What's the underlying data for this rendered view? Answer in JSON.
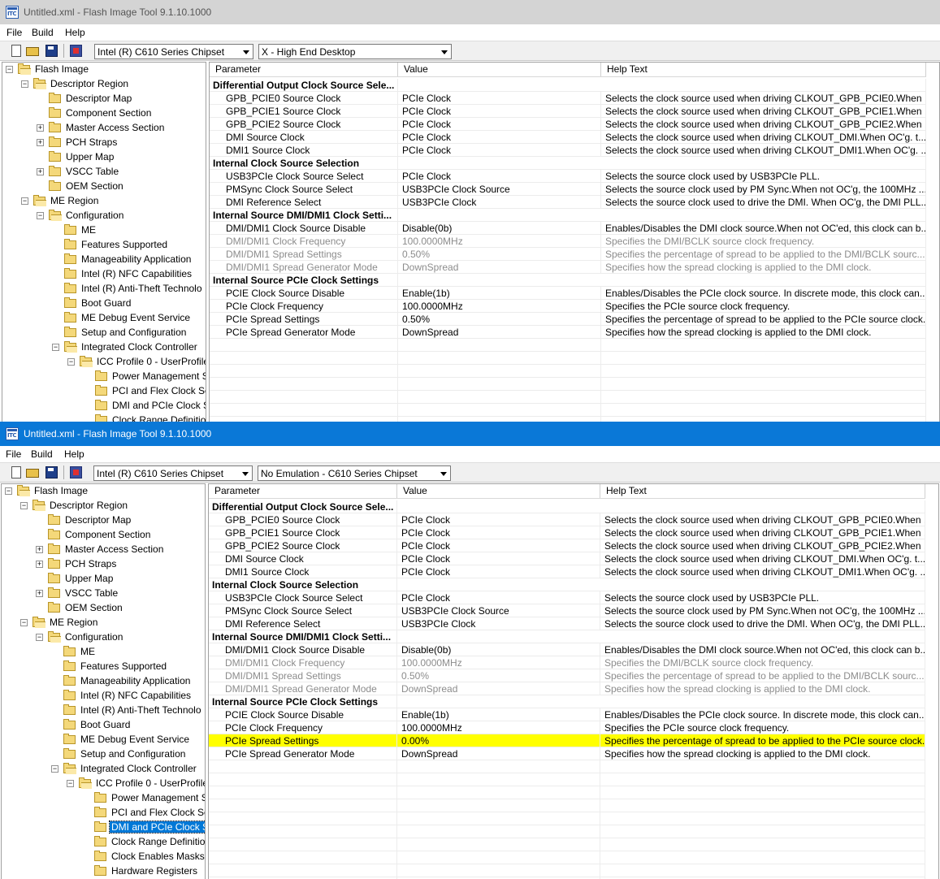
{
  "windows": [
    {
      "title": "Untitled.xml - Flash Image Tool 9.1.10.1000",
      "menu": [
        "File",
        "Build",
        "Help"
      ],
      "chipset": "Intel (R) C610 Series Chipset",
      "emulation": "X - High End Desktop",
      "tree": [
        {
          "label": "Flash Image",
          "level": 0,
          "twisty": "-",
          "open": true
        },
        {
          "label": "Descriptor Region",
          "level": 1,
          "twisty": "-",
          "open": true
        },
        {
          "label": "Descriptor Map",
          "level": 2
        },
        {
          "label": "Component Section",
          "level": 2
        },
        {
          "label": "Master Access Section",
          "level": 2,
          "twisty": "+"
        },
        {
          "label": "PCH Straps",
          "level": 2,
          "twisty": "+"
        },
        {
          "label": "Upper Map",
          "level": 2
        },
        {
          "label": "VSCC Table",
          "level": 2,
          "twisty": "+"
        },
        {
          "label": "OEM Section",
          "level": 2
        },
        {
          "label": "ME Region",
          "level": 1,
          "twisty": "-",
          "open": true
        },
        {
          "label": "Configuration",
          "level": 2,
          "twisty": "-",
          "open": true
        },
        {
          "label": "ME",
          "level": 3
        },
        {
          "label": "Features Supported",
          "level": 3
        },
        {
          "label": "Manageability Application",
          "level": 3
        },
        {
          "label": "Intel (R) NFC Capabilities",
          "level": 3
        },
        {
          "label": "Intel (R) Anti-Theft Technolo",
          "level": 3
        },
        {
          "label": "Boot Guard",
          "level": 3
        },
        {
          "label": "ME Debug Event Service",
          "level": 3
        },
        {
          "label": "Setup and Configuration",
          "level": 3
        },
        {
          "label": "Integrated Clock Controller",
          "level": 3,
          "twisty": "-",
          "open": true
        },
        {
          "label": "ICC Profile 0 - UserProfile",
          "level": 4,
          "twisty": "-",
          "open": true
        },
        {
          "label": "Power Management S",
          "level": 5
        },
        {
          "label": "PCI and Flex Clock Set",
          "level": 5
        },
        {
          "label": "DMI and PCIe Clock S",
          "level": 5
        },
        {
          "label": "Clock Range Definitio",
          "level": 5
        }
      ],
      "columns": [
        "Parameter",
        "Value",
        "Help Text"
      ],
      "rows": [
        {
          "type": "section",
          "param": "Differential Output Clock Source Sele..."
        },
        {
          "param": "GPB_PCIE0 Source Clock",
          "value": "PCIe Clock",
          "help": "Selects the clock source used when driving CLKOUT_GPB_PCIE0.When ..."
        },
        {
          "param": "GPB_PCIE1 Source Clock",
          "value": "PCIe Clock",
          "help": "Selects the clock source used when driving CLKOUT_GPB_PCIE1.When ..."
        },
        {
          "param": "GPB_PCIE2 Source Clock",
          "value": "PCIe Clock",
          "help": "Selects the clock source used when driving CLKOUT_GPB_PCIE2.When ..."
        },
        {
          "param": "DMI Source Clock",
          "value": "PCIe Clock",
          "help": "Selects the clock source used when driving CLKOUT_DMI.When OC'g. t..."
        },
        {
          "param": "DMI1 Source Clock",
          "value": "PCIe Clock",
          "help": "Selects the clock source used when driving CLKOUT_DMI1.When OC'g. ..."
        },
        {
          "type": "section",
          "param": "Internal Clock Source Selection"
        },
        {
          "param": "USB3PCIe Clock Source Select",
          "value": "PCIe Clock",
          "help": "Selects the source clock used by USB3PCIe PLL."
        },
        {
          "param": "PMSync Clock Source Select",
          "value": "USB3PCIe Clock Source",
          "help": "Selects the source clock used by PM Sync.When not OC'g, the 100MHz ..."
        },
        {
          "param": "DMI Reference Select",
          "value": "USB3PCIe Clock",
          "help": "Selects the source clock used to drive the DMI. When OC'g, the DMI PLL..."
        },
        {
          "type": "section",
          "param": "Internal Source DMI/DMI1 Clock Setti..."
        },
        {
          "param": "DMI/DMI1 Clock Source Disable",
          "value": "Disable(0b)",
          "help": "Enables/Disables the DMI clock source.When not OC'ed, this clock can b..."
        },
        {
          "param": "DMI/DMI1 Clock Frequency",
          "value": "100.0000MHz",
          "help": "Specifies the DMI/BCLK source clock frequency.",
          "disabled": true
        },
        {
          "param": "DMI/DMI1 Spread Settings",
          "value": "0.50%",
          "help": "Specifies the percentage of spread to be applied to the DMI/BCLK sourc...",
          "disabled": true
        },
        {
          "param": "DMI/DMI1 Spread Generator Mode",
          "value": "DownSpread",
          "help": "Specifies how the spread clocking is applied to the DMI clock.",
          "disabled": true
        },
        {
          "type": "section",
          "param": "Internal Source PCIe Clock Settings"
        },
        {
          "param": "PCIE Clock Source Disable",
          "value": "Enable(1b)",
          "help": "Enables/Disables the PCIe clock source.  In discrete mode, this clock can..."
        },
        {
          "param": "PCIe Clock Frequency",
          "value": "100.0000MHz",
          "help": "Specifies the PCIe source clock frequency."
        },
        {
          "param": "PCIe Spread Settings",
          "value": "0.50%",
          "help": "Specifies the percentage of spread to be applied to the PCIe source clock."
        },
        {
          "param": "PCIe Spread Generator Mode",
          "value": "DownSpread",
          "help": "Specifies how the spread clocking is applied to the DMI clock."
        }
      ]
    },
    {
      "title": "Untitled.xml - Flash Image Tool 9.1.10.1000",
      "menu": [
        "File",
        "Build",
        "Help"
      ],
      "chipset": "Intel (R) C610 Series Chipset",
      "emulation": "No Emulation - C610 Series Chipset",
      "tree": [
        {
          "label": "Flash Image",
          "level": 0,
          "twisty": "-",
          "open": true
        },
        {
          "label": "Descriptor Region",
          "level": 1,
          "twisty": "-",
          "open": true
        },
        {
          "label": "Descriptor Map",
          "level": 2
        },
        {
          "label": "Component Section",
          "level": 2
        },
        {
          "label": "Master Access Section",
          "level": 2,
          "twisty": "+"
        },
        {
          "label": "PCH Straps",
          "level": 2,
          "twisty": "+"
        },
        {
          "label": "Upper Map",
          "level": 2
        },
        {
          "label": "VSCC Table",
          "level": 2,
          "twisty": "+"
        },
        {
          "label": "OEM Section",
          "level": 2
        },
        {
          "label": "ME Region",
          "level": 1,
          "twisty": "-",
          "open": true
        },
        {
          "label": "Configuration",
          "level": 2,
          "twisty": "-",
          "open": true
        },
        {
          "label": "ME",
          "level": 3
        },
        {
          "label": "Features Supported",
          "level": 3
        },
        {
          "label": "Manageability Application",
          "level": 3
        },
        {
          "label": "Intel (R) NFC Capabilities",
          "level": 3
        },
        {
          "label": "Intel (R) Anti-Theft Technolo",
          "level": 3
        },
        {
          "label": "Boot Guard",
          "level": 3
        },
        {
          "label": "ME Debug Event Service",
          "level": 3
        },
        {
          "label": "Setup and Configuration",
          "level": 3
        },
        {
          "label": "Integrated Clock Controller",
          "level": 3,
          "twisty": "-",
          "open": true
        },
        {
          "label": "ICC Profile 0 - UserProfile",
          "level": 4,
          "twisty": "-",
          "open": true
        },
        {
          "label": "Power Management S",
          "level": 5
        },
        {
          "label": "PCI and Flex Clock Set",
          "level": 5
        },
        {
          "label": "DMI and PCIe Clock S",
          "level": 5,
          "selected": true
        },
        {
          "label": "Clock Range Definitio",
          "level": 5
        },
        {
          "label": "Clock Enables Masks",
          "level": 5
        },
        {
          "label": "Hardware Registers",
          "level": 5
        }
      ],
      "columns": [
        "Parameter",
        "Value",
        "Help Text"
      ],
      "rows": [
        {
          "type": "section",
          "param": "Differential Output Clock Source Sele..."
        },
        {
          "param": "GPB_PCIE0 Source Clock",
          "value": "PCIe Clock",
          "help": "Selects the clock source used when driving CLKOUT_GPB_PCIE0.When ..."
        },
        {
          "param": "GPB_PCIE1 Source Clock",
          "value": "PCIe Clock",
          "help": "Selects the clock source used when driving CLKOUT_GPB_PCIE1.When ..."
        },
        {
          "param": "GPB_PCIE2 Source Clock",
          "value": "PCIe Clock",
          "help": "Selects the clock source used when driving CLKOUT_GPB_PCIE2.When ..."
        },
        {
          "param": "DMI Source Clock",
          "value": "PCIe Clock",
          "help": "Selects the clock source used when driving CLKOUT_DMI.When OC'g. t..."
        },
        {
          "param": "DMI1 Source Clock",
          "value": "PCIe Clock",
          "help": "Selects the clock source used when driving CLKOUT_DMI1.When OC'g. ..."
        },
        {
          "type": "section",
          "param": "Internal Clock Source Selection"
        },
        {
          "param": "USB3PCIe Clock Source Select",
          "value": "PCIe Clock",
          "help": "Selects the source clock used by USB3PCIe PLL."
        },
        {
          "param": "PMSync Clock Source Select",
          "value": "USB3PCIe Clock Source",
          "help": "Selects the source clock used by PM Sync.When not OC'g, the 100MHz ..."
        },
        {
          "param": "DMI Reference Select",
          "value": "USB3PCIe Clock",
          "help": "Selects the source clock used to drive the DMI. When OC'g, the DMI PLL..."
        },
        {
          "type": "section",
          "param": "Internal Source DMI/DMI1 Clock Setti..."
        },
        {
          "param": "DMI/DMI1 Clock Source Disable",
          "value": "Disable(0b)",
          "help": "Enables/Disables the DMI clock source.When not OC'ed, this clock can b..."
        },
        {
          "param": "DMI/DMI1 Clock Frequency",
          "value": "100.0000MHz",
          "help": "Specifies the DMI/BCLK source clock frequency.",
          "disabled": true
        },
        {
          "param": "DMI/DMI1 Spread Settings",
          "value": "0.50%",
          "help": "Specifies the percentage of spread to be applied to the DMI/BCLK sourc...",
          "disabled": true
        },
        {
          "param": "DMI/DMI1 Spread Generator Mode",
          "value": "DownSpread",
          "help": "Specifies how the spread clocking is applied to the DMI clock.",
          "disabled": true
        },
        {
          "type": "section",
          "param": "Internal Source PCIe Clock Settings"
        },
        {
          "param": "PCIE Clock Source Disable",
          "value": "Enable(1b)",
          "help": "Enables/Disables the PCIe clock source.  In discrete mode, this clock can..."
        },
        {
          "param": "PCIe Clock Frequency",
          "value": "100.0000MHz",
          "help": "Specifies the PCIe source clock frequency."
        },
        {
          "param": "PCIe Spread Settings",
          "value": "0.00%",
          "help": "Specifies the percentage of spread to be applied to the PCIe source clock.",
          "highlight": true
        },
        {
          "param": "PCIe Spread Generator Mode",
          "value": "DownSpread",
          "help": "Specifies how the spread clocking is applied to the DMI clock."
        }
      ]
    }
  ],
  "colors": {
    "highlight": "#ffff00",
    "active_titlebar": "#0a78d7",
    "inactive_titlebar": "#d4d4d4",
    "selection": "#0078d7"
  }
}
